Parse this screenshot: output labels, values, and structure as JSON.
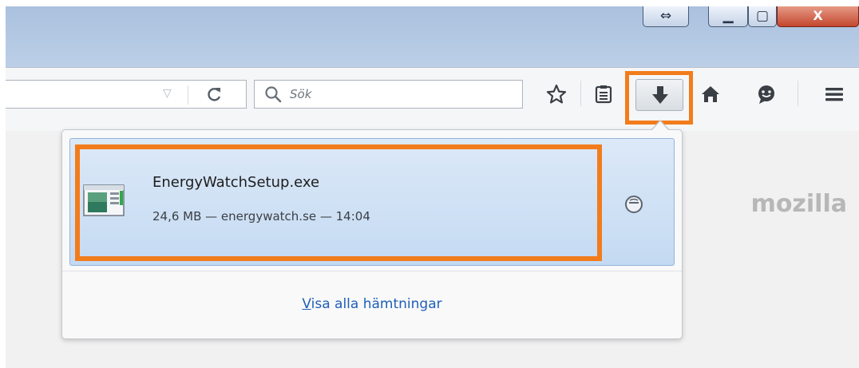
{
  "window": {
    "buttons": [
      {
        "name": "resize",
        "glyph": "⇔"
      },
      {
        "name": "minimize",
        "glyph": "▁"
      },
      {
        "name": "maximize",
        "glyph": "▢"
      },
      {
        "name": "close",
        "glyph": "X"
      }
    ]
  },
  "toolbar": {
    "search_placeholder": "Sök",
    "icons": [
      "dropdown-icon",
      "reload-icon",
      "search-icon",
      "bookmark-star-icon",
      "reading-list-icon",
      "download-icon",
      "home-icon",
      "chat-icon",
      "menu-icon"
    ]
  },
  "colors": {
    "highlight": "#f27c1c",
    "link": "#1f5fb8",
    "selected_item": "#c4daf2"
  },
  "page": {
    "logo_text": "mozilla"
  },
  "downloads_panel": {
    "items": [
      {
        "filename": "EnergyWatchSetup.exe",
        "meta": "24,6 MB — energywatch.se — 14:04",
        "icon": "executable-file-icon",
        "action_icon": "open-folder-icon"
      }
    ],
    "show_all_label": "Visa alla hämtningar"
  }
}
